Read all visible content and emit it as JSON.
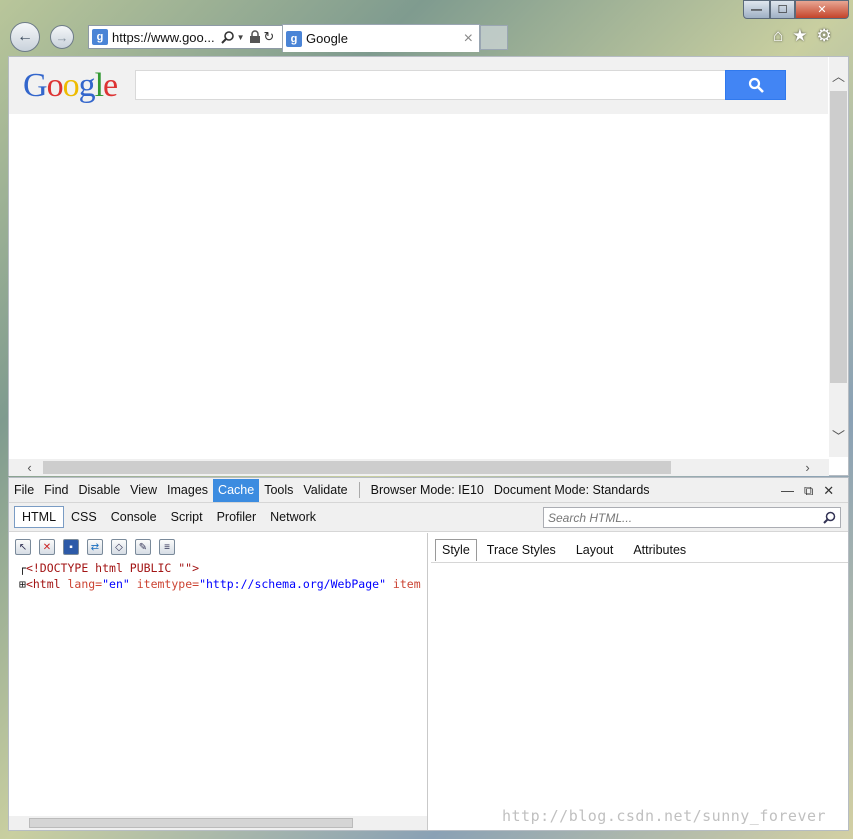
{
  "window": {
    "minimize": "—",
    "maximize": "☐",
    "close": "✕"
  },
  "browser": {
    "back_glyph": "←",
    "forward_glyph": "→",
    "address": "https://www.goo...",
    "tab_title": "Google",
    "tab_close": "×",
    "favicon_letter": "g",
    "home_glyph": "⌂",
    "favorites_glyph": "★",
    "tools_glyph": "⚙"
  },
  "page": {
    "logo": [
      "G",
      "o",
      "o",
      "g",
      "l",
      "e"
    ],
    "logo_colors": [
      "#3366cc",
      "#dd3333",
      "#eebb00",
      "#3366cc",
      "#339933",
      "#dd3333"
    ],
    "search_value": ""
  },
  "devtools": {
    "menu": [
      "File",
      "Find",
      "Disable",
      "View",
      "Images",
      "Cache",
      "Tools",
      "Validate"
    ],
    "highlighted_menu": "Cache",
    "browser_mode": "Browser Mode: IE10",
    "document_mode": "Document Mode: Standards",
    "tabs": [
      "HTML",
      "CSS",
      "Console",
      "Script",
      "Profiler",
      "Network"
    ],
    "active_tab": "HTML",
    "search_placeholder": "Search HTML...",
    "tree": {
      "line1": "<!DOCTYPE html PUBLIC \"\">",
      "line2_tag": "<html",
      "line2_a1": " lang=",
      "line2_v1": "\"en\"",
      "line2_a2": " itemtype=",
      "line2_v2": "\"http://schema.org/WebPage\"",
      "line2_a3": " item"
    },
    "right_tabs": [
      "Style",
      "Trace Styles",
      "Layout",
      "Attributes"
    ],
    "active_right_tab": "Style"
  },
  "watermark": "http://blog.csdn.net/sunny_forever"
}
